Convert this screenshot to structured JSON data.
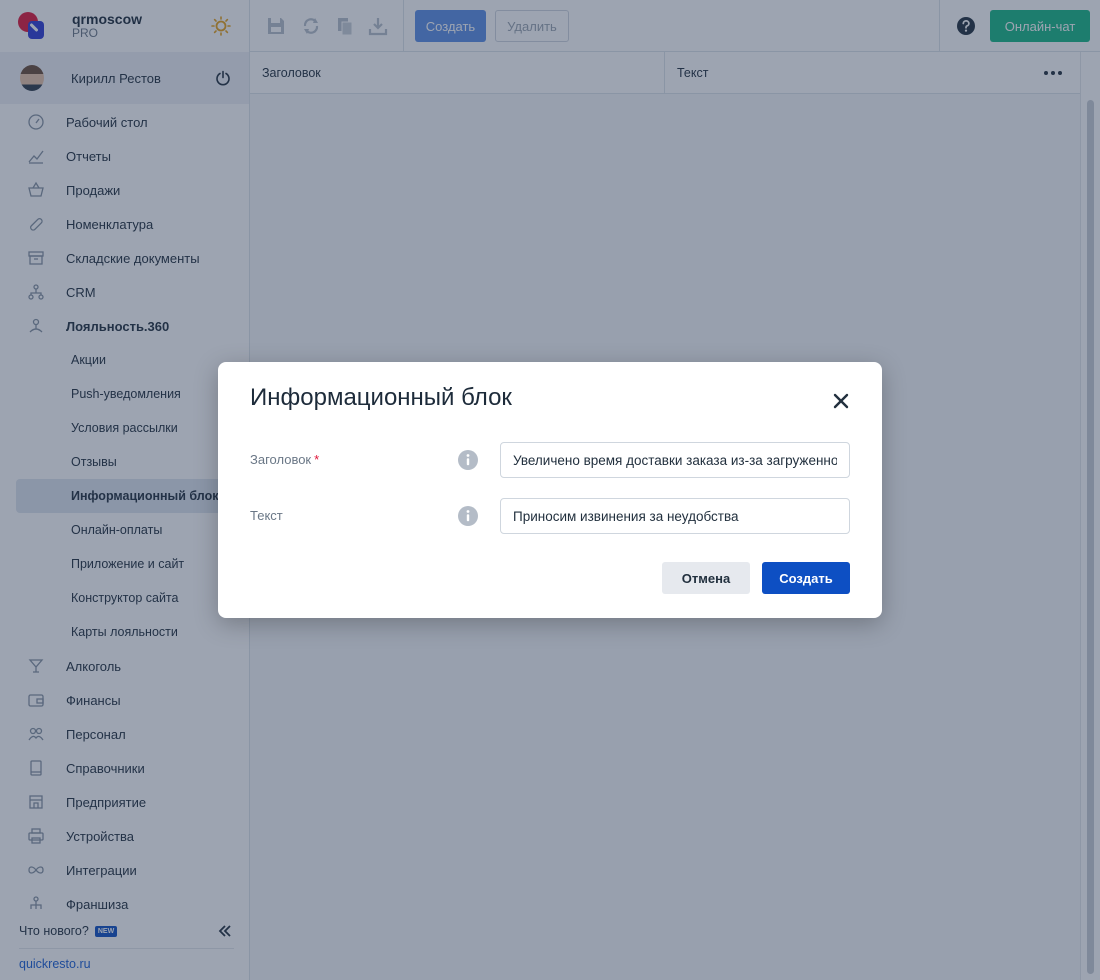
{
  "brand": {
    "name": "qrmoscow",
    "plan": "PRO"
  },
  "user": {
    "name": "Кирилл Рестов"
  },
  "sidebar": {
    "items": [
      {
        "label": "Рабочий стол",
        "icon": "speedometer-icon"
      },
      {
        "label": "Отчеты",
        "icon": "chart-icon"
      },
      {
        "label": "Продажи",
        "icon": "basket-icon"
      },
      {
        "label": "Номенклатура",
        "icon": "link-icon"
      },
      {
        "label": "Складские документы",
        "icon": "archive-icon"
      },
      {
        "label": "CRM",
        "icon": "hierarchy-icon"
      },
      {
        "label": "Лояльность.360",
        "icon": "loyalty-icon"
      }
    ],
    "loyalty_sub": [
      "Акции",
      "Push-уведомления",
      "Условия рассылки",
      "Отзывы",
      "Информационный блок",
      "Онлайн-оплаты",
      "Приложение и сайт",
      "Конструктор сайта",
      "Карты лояльности"
    ],
    "items_after": [
      {
        "label": "Алкоголь",
        "icon": "cocktail-icon"
      },
      {
        "label": "Финансы",
        "icon": "wallet-icon"
      },
      {
        "label": "Персонал",
        "icon": "people-icon"
      },
      {
        "label": "Справочники",
        "icon": "book-icon"
      },
      {
        "label": "Предприятие",
        "icon": "store-icon"
      },
      {
        "label": "Устройства",
        "icon": "printer-icon"
      },
      {
        "label": "Интеграции",
        "icon": "infinity-icon"
      },
      {
        "label": "Франшиза",
        "icon": "franchise-icon"
      }
    ],
    "whats_new": "Что нового?",
    "new_badge": "NEW",
    "site_link": "quickresto.ru"
  },
  "toolbar": {
    "create_label": "Создать",
    "delete_label": "Удалить",
    "chat_label": "Онлайн-чат"
  },
  "grid": {
    "columns": [
      "Заголовок",
      "Текст"
    ]
  },
  "modal": {
    "title": "Информационный блок",
    "title_label": "Заголовок",
    "required_mark": "*",
    "title_value": "Увеличено время доставки заказа из-за загруженности",
    "text_label": "Текст",
    "text_value": "Приносим извинения за неудобства",
    "cancel_label": "Отмена",
    "submit_label": "Создать"
  },
  "colors": {
    "accent": "#0d4fc3",
    "chat": "#16b885",
    "brand_red": "#e0163a"
  }
}
